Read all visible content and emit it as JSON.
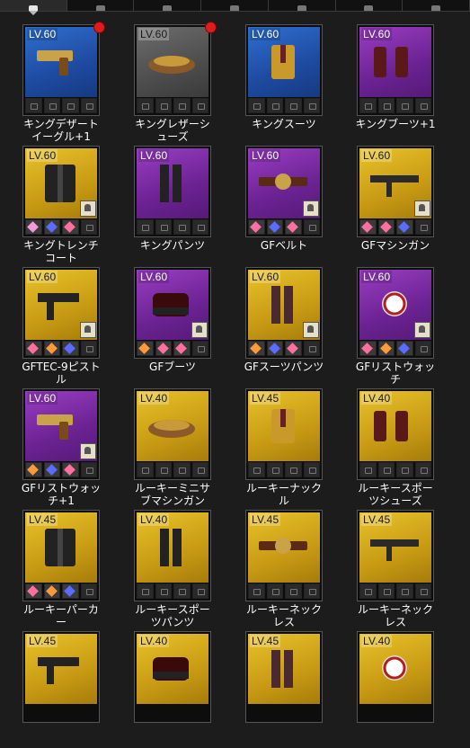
{
  "tabs": [
    {
      "icon": "equipment-icon",
      "active": true
    },
    {
      "icon": "key-icon",
      "active": false
    },
    {
      "icon": "pen-icon",
      "active": false
    },
    {
      "icon": "shirt-icon",
      "active": false
    },
    {
      "icon": "pants-icon",
      "active": false
    },
    {
      "icon": "feather-icon",
      "active": false
    },
    {
      "icon": "ring-icon",
      "active": false
    }
  ],
  "items": [
    {
      "level": "LV.60",
      "name": "キングデザート\nイーグル+1",
      "rarity": "blue",
      "dot": true,
      "gems": [
        "lock",
        "lock",
        "lock",
        "lock"
      ],
      "badge": false
    },
    {
      "level": "LV.60",
      "name": "キングレザーシ\nューズ",
      "rarity": "gray",
      "dot": true,
      "gems": [
        "lock",
        "lock",
        "lock",
        "lock"
      ],
      "badge": false
    },
    {
      "level": "LV.60",
      "name": "キングスーツ",
      "rarity": "blue",
      "dot": false,
      "gems": [
        "lock",
        "lock",
        "lock",
        "lock"
      ],
      "badge": false
    },
    {
      "level": "LV.60",
      "name": "キングブーツ+1",
      "rarity": "purple",
      "dot": false,
      "gems": [
        "lock",
        "lock",
        "lock",
        "lock"
      ],
      "badge": false
    },
    {
      "level": "LV.60",
      "name": "キングトレンチ\nコート",
      "rarity": "gold",
      "dot": false,
      "gems": [
        "#f29bd8",
        "#5a6cff",
        "#ff6fa0",
        "lock"
      ],
      "badge": true
    },
    {
      "level": "LV.60",
      "name": "キングパンツ",
      "rarity": "purple",
      "dot": false,
      "gems": [
        "lock",
        "lock",
        "lock",
        "lock"
      ],
      "badge": false
    },
    {
      "level": "LV.60",
      "name": "GFベルト",
      "rarity": "purple",
      "dot": false,
      "gems": [
        "#ff6fa0",
        "#5a6cff",
        "#ff6fa0",
        "lock"
      ],
      "badge": true
    },
    {
      "level": "LV.60",
      "name": "GFマシンガン",
      "rarity": "gold",
      "dot": false,
      "gems": [
        "#ff6fa0",
        "#ff6fa0",
        "#5a6cff",
        "lock"
      ],
      "badge": true
    },
    {
      "level": "LV.60",
      "name": "GFTEC-9ピスト\nル",
      "rarity": "gold",
      "dot": false,
      "gems": [
        "#ff6fa0",
        "#ff9a3a",
        "#5a6cff",
        "lock"
      ],
      "badge": true
    },
    {
      "level": "LV.60",
      "name": "GFブーツ",
      "rarity": "purple",
      "dot": false,
      "gems": [
        "#ff9a3a",
        "#ff6fa0",
        "#ff6fa0",
        "lock"
      ],
      "badge": true
    },
    {
      "level": "LV.60",
      "name": "GFスーツパンツ",
      "rarity": "gold",
      "dot": false,
      "gems": [
        "#ff9a3a",
        "#5a6cff",
        "#ff6fa0",
        "lock"
      ],
      "badge": true
    },
    {
      "level": "LV.60",
      "name": "GFリストウォッ\nチ",
      "rarity": "purple",
      "dot": false,
      "gems": [
        "#ff6fa0",
        "#ff9a3a",
        "#5a6cff",
        "lock"
      ],
      "badge": true
    },
    {
      "level": "LV.60",
      "name": "GFリストウォッ\nチ+1",
      "rarity": "purple",
      "dot": false,
      "gems": [
        "#ff9a3a",
        "#5a6cff",
        "#ff6fa0",
        "lock"
      ],
      "badge": true
    },
    {
      "level": "LV.40",
      "name": "ルーキーミニサ\nブマシンガン",
      "rarity": "gold",
      "dot": false,
      "gems": [
        "lock",
        "lock",
        "lock",
        "lock"
      ],
      "badge": false
    },
    {
      "level": "LV.45",
      "name": "ルーキーナック\nル",
      "rarity": "gold",
      "dot": false,
      "gems": [
        "lock",
        "lock",
        "lock",
        "lock"
      ],
      "badge": false
    },
    {
      "level": "LV.40",
      "name": "ルーキースポー\nツシューズ",
      "rarity": "gold",
      "dot": false,
      "gems": [
        "lock",
        "lock",
        "lock",
        "lock"
      ],
      "badge": false
    },
    {
      "level": "LV.45",
      "name": "ルーキーパーカ\nー",
      "rarity": "gold",
      "dot": false,
      "gems": [
        "#ff6fa0",
        "#ff9a3a",
        "#5a6cff",
        "lock"
      ],
      "badge": false
    },
    {
      "level": "LV.40",
      "name": "ルーキースポー\nツパンツ",
      "rarity": "gold",
      "dot": false,
      "gems": [
        "lock",
        "lock",
        "lock",
        "lock"
      ],
      "badge": false
    },
    {
      "level": "LV.45",
      "name": "ルーキーネック\nレス",
      "rarity": "gold",
      "dot": false,
      "gems": [
        "lock",
        "lock",
        "lock",
        "lock"
      ],
      "badge": false
    },
    {
      "level": "LV.45",
      "name": "ルーキーネック\nレス",
      "rarity": "gold",
      "dot": false,
      "gems": [
        "lock",
        "lock",
        "lock",
        "lock"
      ],
      "badge": false
    },
    {
      "level": "LV.45",
      "name": "",
      "rarity": "gold",
      "dot": false,
      "gems": [],
      "badge": false
    },
    {
      "level": "LV.40",
      "name": "",
      "rarity": "gold",
      "dot": false,
      "gems": [],
      "badge": false
    },
    {
      "level": "LV.45",
      "name": "",
      "rarity": "gold",
      "dot": false,
      "gems": [],
      "badge": false
    },
    {
      "level": "LV.40",
      "name": "",
      "rarity": "gold",
      "dot": false,
      "gems": [],
      "badge": false
    }
  ]
}
